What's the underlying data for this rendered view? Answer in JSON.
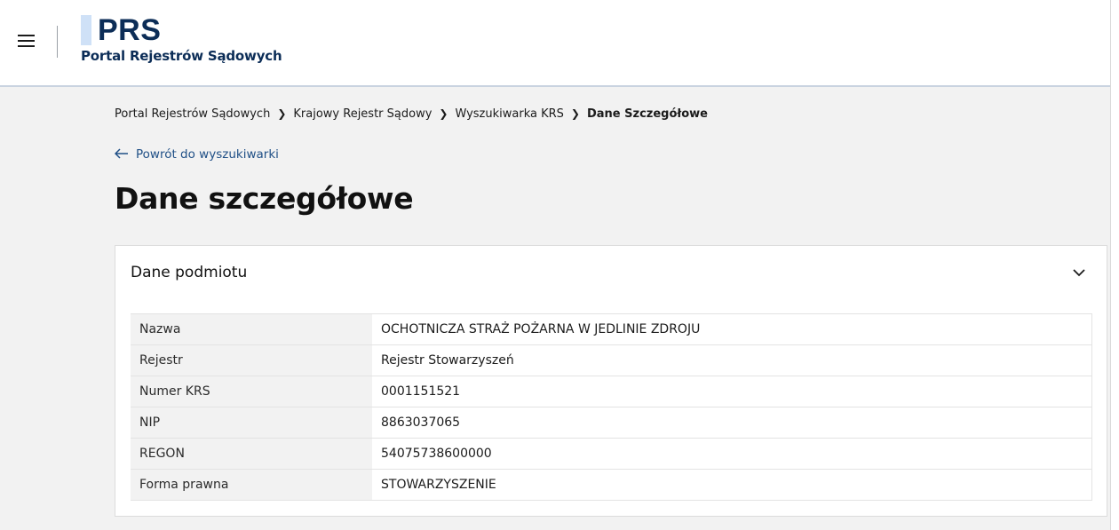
{
  "header": {
    "logo": "PRS",
    "subtitle": "Portal Rejestrów Sądowych"
  },
  "breadcrumb": {
    "items": [
      "Portal Rejestrów Sądowych",
      "Krajowy Rejestr Sądowy",
      "Wyszukiwarka KRS",
      "Dane Szczegółowe"
    ]
  },
  "back_link": "Powrót do wyszukiwarki",
  "page_title": "Dane szczegółowe",
  "card": {
    "title": "Dane podmiotu",
    "rows": [
      {
        "label": "Nazwa",
        "value": "OCHOTNICZA STRAŻ POŻARNA W JEDLINIE ZDROJU"
      },
      {
        "label": "Rejestr",
        "value": "Rejestr Stowarzyszeń"
      },
      {
        "label": "Numer KRS",
        "value": "0001151521"
      },
      {
        "label": "NIP",
        "value": "8863037065"
      },
      {
        "label": "REGON",
        "value": "54075738600000"
      },
      {
        "label": "Forma prawna",
        "value": "STOWARZYSZENIE"
      }
    ]
  },
  "icons": {
    "menu": "hamburger-menu-icon",
    "back": "arrow-left-icon",
    "breadcrumb_separator": "chevron-right-icon",
    "collapse": "chevron-down-icon"
  },
  "colors": {
    "brand": "#0c2d57",
    "link": "#1f4f86",
    "logo_accent": "#cfe1f7",
    "background": "#f2f2f2"
  }
}
